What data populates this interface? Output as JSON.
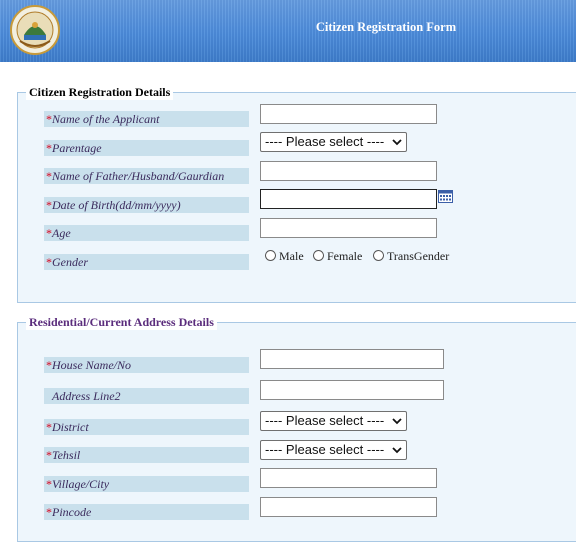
{
  "header": {
    "title": "Citizen Registration Form"
  },
  "section1": {
    "legend": "Citizen Registration Details",
    "fields": {
      "applicant_name": {
        "label": "Name of the Applicant",
        "value": ""
      },
      "parentage": {
        "label": "Parentage",
        "selected": "---- Please select ----"
      },
      "father_name": {
        "label": "Name of Father/Husband/Gaurdian",
        "value": ""
      },
      "dob": {
        "label": "Date of Birth(dd/mm/yyyy)",
        "value": ""
      },
      "age": {
        "label": "Age",
        "value": ""
      },
      "gender": {
        "label": "Gender",
        "options": [
          "Male",
          "Female",
          "TransGender"
        ]
      }
    }
  },
  "section2": {
    "legend": "Residential/Current Address Details",
    "fields": {
      "house": {
        "label": "House Name/No",
        "value": ""
      },
      "address2": {
        "label": "Address Line2",
        "value": ""
      },
      "district": {
        "label": "District",
        "selected": "---- Please select ----"
      },
      "tehsil": {
        "label": "Tehsil",
        "selected": "---- Please select ----"
      },
      "village": {
        "label": "Village/City",
        "value": ""
      },
      "pincode": {
        "label": "Pincode",
        "value": ""
      }
    }
  },
  "required_marker": "*",
  "colors": {
    "header_blue": "#4586d6",
    "required_red": "#d8001c",
    "panel_bg": "#eef6fc",
    "label_bg": "#c9e0ec"
  }
}
